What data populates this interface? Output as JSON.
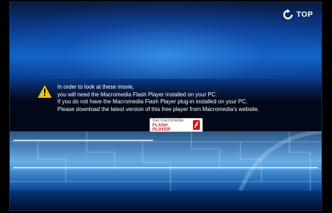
{
  "top_button": {
    "label": "TOP",
    "icon": "refresh-arrow-icon"
  },
  "notice": {
    "icon": "warning-triangle-icon",
    "lines": [
      "In order to look at these movie,",
      "you will need the Macromedia Flash Player installed on your PC.",
      "If you do not have the Macromedia Flash Player plug-in installed on your PC.",
      "Please download the latest version of this free player from Macromedia's website."
    ]
  },
  "flash_badge": {
    "line1": "Get macromedia",
    "line2": "FLASH",
    "line3": "PLAYER",
    "icon": "flash-f-icon"
  },
  "colors": {
    "accent_blue": "#0f66c6",
    "warning_yellow": "#f5c400",
    "flash_red": "#d11111"
  }
}
